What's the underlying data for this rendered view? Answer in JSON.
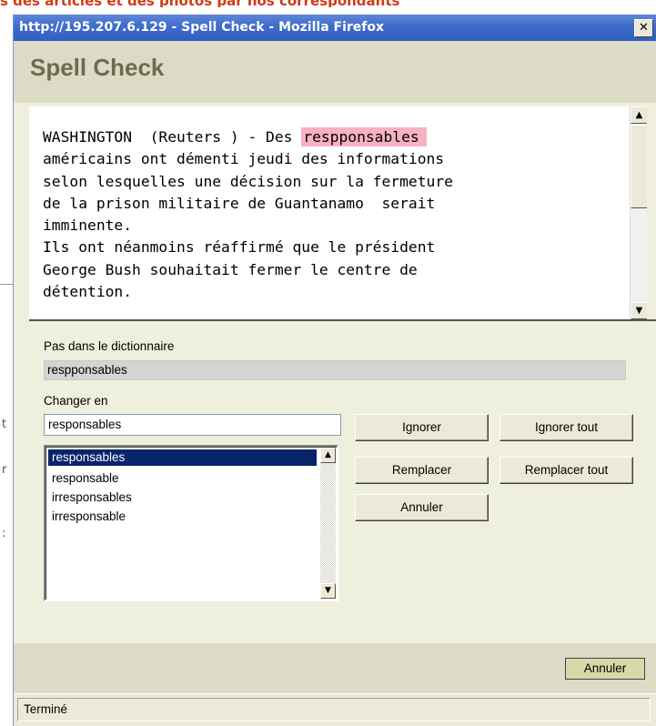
{
  "window": {
    "title": "http://195.207.6.129 - Spell Check - Mozilla Firefox",
    "close_glyph": "✕"
  },
  "header": {
    "title": "Spell Check"
  },
  "text": {
    "before": "WASHINGTON  (Reuters ) - Des ",
    "misspelled": "respponsables",
    "after": "\naméricains ont démenti jeudi des informations\nselon lesquelles une décision sur la fermeture\nde la prison militaire de Guantanamo  serait\nimminente.\nIls ont néanmoins réaffirmé que le président\nGeorge Bush souhaitait fermer le centre de\ndétention."
  },
  "form": {
    "not_in_dict_label": "Pas dans le dictionnaire",
    "not_in_dict_value": "respponsables",
    "change_to_label": "Changer en",
    "change_to_value": "responsables"
  },
  "suggestions": [
    "responsables",
    "responsable",
    "irresponsables",
    "irresponsable"
  ],
  "buttons": {
    "ignore": "Ignorer",
    "ignore_all": "Ignorer tout",
    "replace": "Remplacer",
    "replace_all": "Remplacer tout",
    "undo": "Annuler"
  },
  "footer": {
    "cancel": "Annuler"
  },
  "status": {
    "text": "Terminé"
  },
  "icons": {
    "scroll_up": "▲",
    "scroll_down": "▼"
  }
}
